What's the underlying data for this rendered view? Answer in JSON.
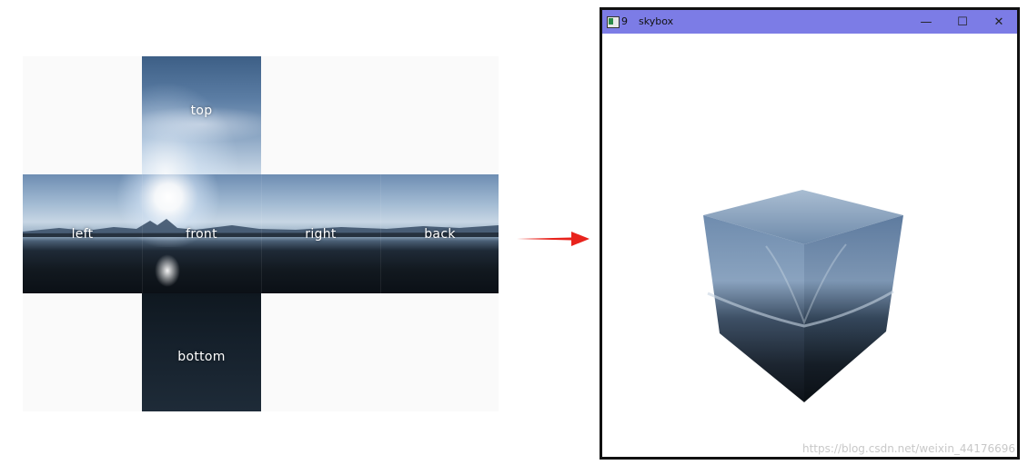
{
  "cubemap": {
    "faces": {
      "top": "top",
      "left": "left",
      "front": "front",
      "right": "right",
      "back": "back",
      "bottom": "bottom"
    }
  },
  "arrow": {
    "color": "#e8231c"
  },
  "window": {
    "number": "9",
    "title": "skybox",
    "titlebar_color": "#7c7ce6",
    "buttons": {
      "minimize": "—",
      "maximize": "☐",
      "close": "✕"
    }
  },
  "watermark": "https://blog.csdn.net/weixin_44176696"
}
